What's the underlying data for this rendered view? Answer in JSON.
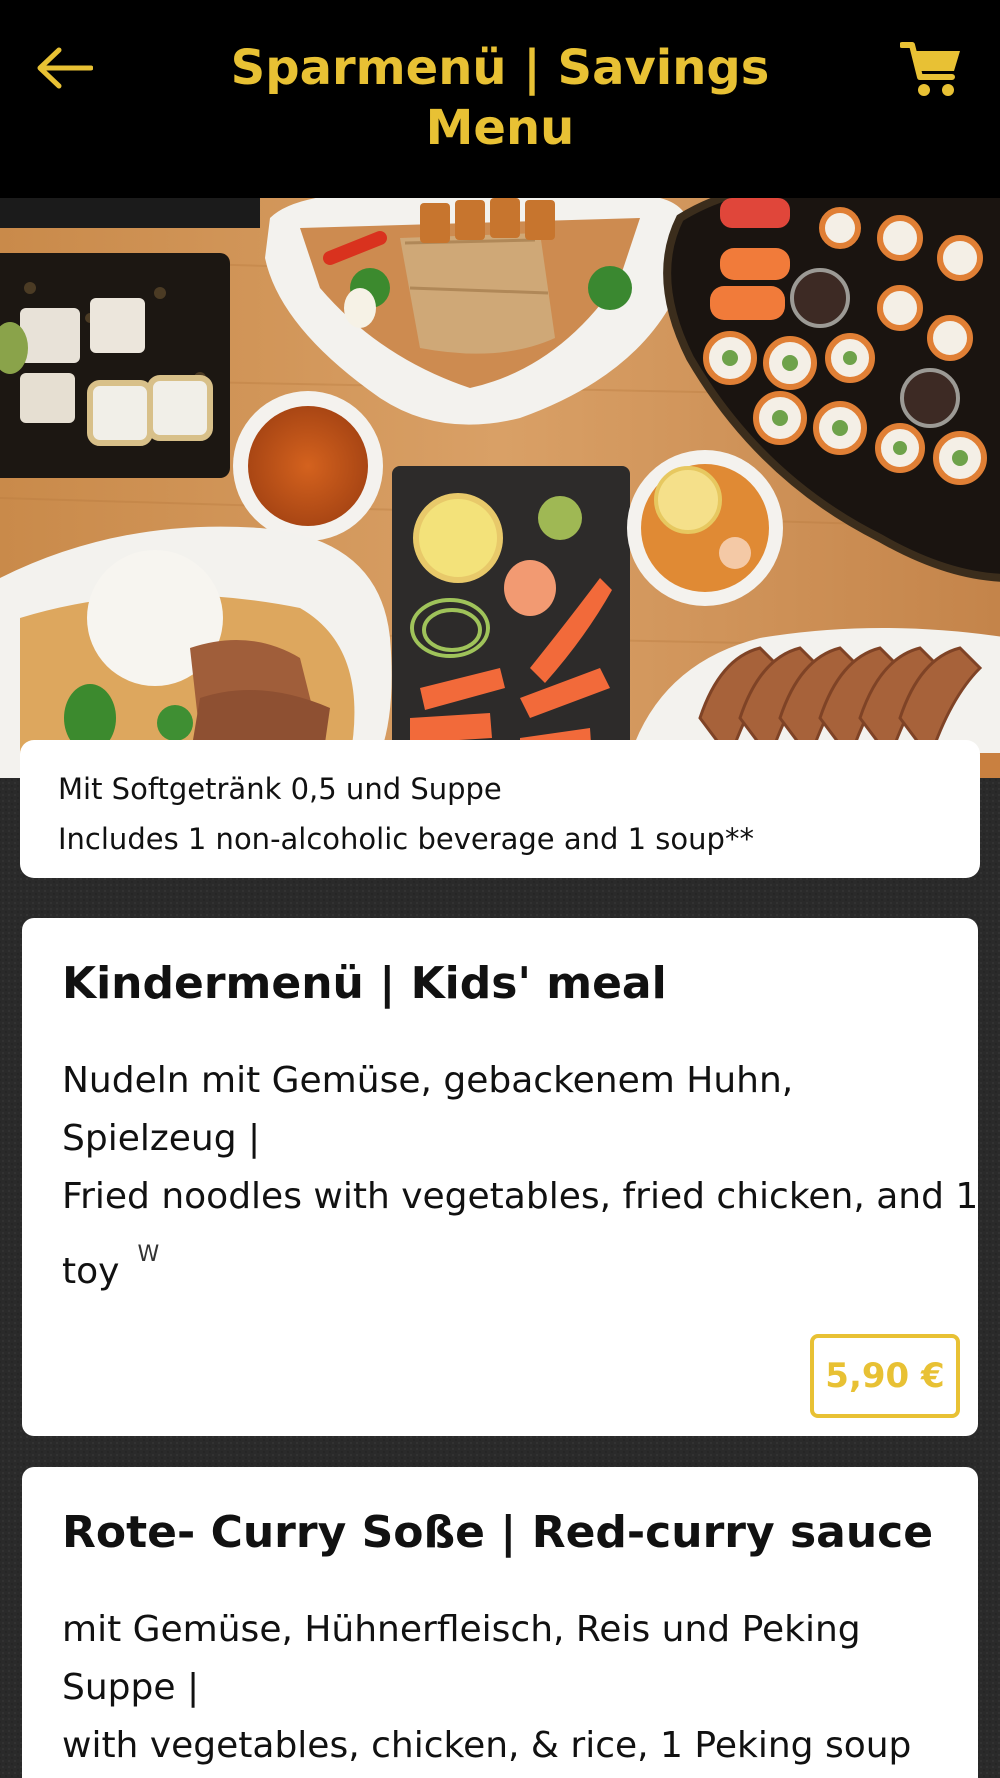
{
  "header": {
    "title": "Sparmenü | Savings Menu",
    "back_icon": "arrow-left-icon",
    "cart_icon": "shopping-cart-icon",
    "accent_color": "#e8c134",
    "background_color": "#000000"
  },
  "hero": {
    "image": "food-spread-photo"
  },
  "notice": {
    "line1": "Mit Softgetränk 0,5 und Suppe",
    "line2": "Includes 1 non-alcoholic beverage and 1 soup**"
  },
  "items": [
    {
      "title": "Kindermenü | Kids' meal",
      "desc_lines": [
        "Nudeln mit Gemüse, gebackenem Huhn,",
        "Spielzeug |",
        "Fried noodles with vegetables, fried chicken, and 1",
        "toy"
      ],
      "allergen": "W",
      "price": "5,90 €"
    },
    {
      "title": "Rote- Curry Soße | Red-curry sauce",
      "desc_lines": [
        "mit Gemüse, Hühnerfleisch, Reis und Peking",
        "Suppe |",
        "with vegetables, chicken, & rice, 1 Peking soup"
      ]
    }
  ]
}
